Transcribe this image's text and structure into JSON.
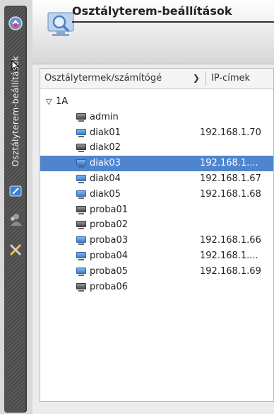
{
  "sidebar": {
    "vertical_tab_label": "Osztályterem-beállítások",
    "icons": [
      "app-logo-icon",
      "classroom-settings-icon",
      "monitor-blue-icon",
      "users-icon",
      "tools-icon"
    ]
  },
  "header": {
    "title": "Osztályterem-beállítások",
    "icon": "monitor-magnifier-icon"
  },
  "table": {
    "columns": [
      "Osztálytermek/számítógé",
      "IP-címek"
    ],
    "group": {
      "label": "1A",
      "expanded": true
    },
    "rows": [
      {
        "name": "admin",
        "ip": "",
        "status": "off",
        "selected": false
      },
      {
        "name": "diak01",
        "ip": "192.168.1.70",
        "status": "on",
        "selected": false
      },
      {
        "name": "diak02",
        "ip": "",
        "status": "off",
        "selected": false
      },
      {
        "name": "diak03",
        "ip": "192.168.1....",
        "status": "on",
        "selected": true
      },
      {
        "name": "diak04",
        "ip": "192.168.1.67",
        "status": "on",
        "selected": false
      },
      {
        "name": "diak05",
        "ip": "192.168.1.68",
        "status": "on",
        "selected": false
      },
      {
        "name": "proba01",
        "ip": "",
        "status": "off",
        "selected": false
      },
      {
        "name": "proba02",
        "ip": "",
        "status": "off",
        "selected": false
      },
      {
        "name": "proba03",
        "ip": "192.168.1.66",
        "status": "on",
        "selected": false
      },
      {
        "name": "proba04",
        "ip": "192.168.1....",
        "status": "on",
        "selected": false
      },
      {
        "name": "proba05",
        "ip": "192.168.1.69",
        "status": "on",
        "selected": false
      },
      {
        "name": "proba06",
        "ip": "",
        "status": "off",
        "selected": false
      }
    ]
  },
  "colors": {
    "selection": "#4f84cf",
    "computer_on": "#3d7fcf",
    "computer_off": "#4a4a4a"
  }
}
